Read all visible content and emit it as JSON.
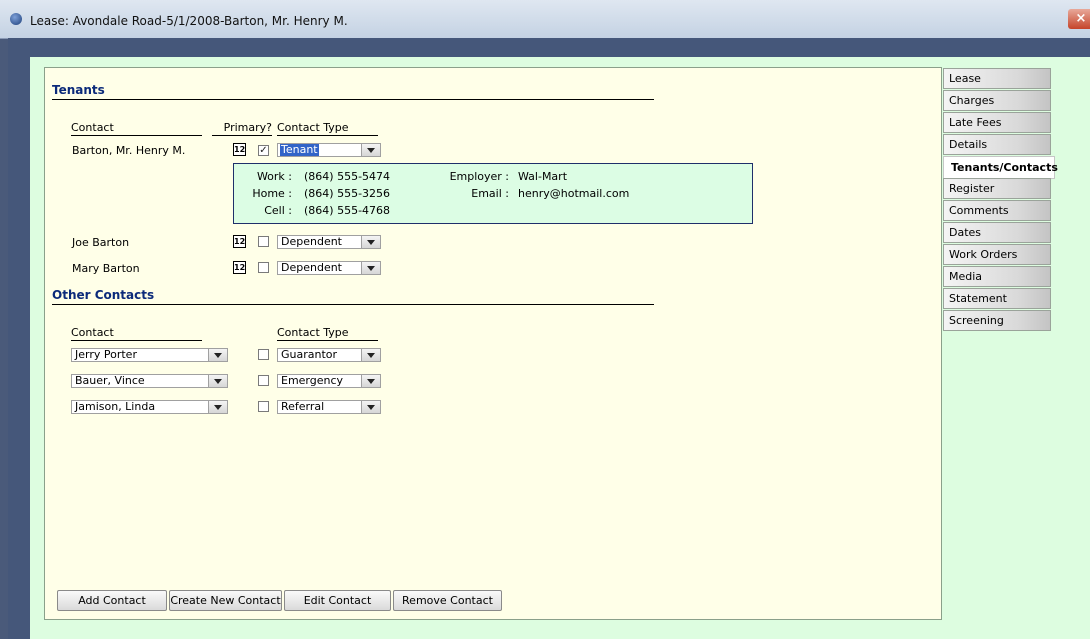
{
  "window": {
    "title": "Lease: Avondale Road-5/1/2008-Barton, Mr. Henry M.",
    "close_glyph": "×"
  },
  "tenants": {
    "title": "Tenants",
    "headers": {
      "contact": "Contact",
      "primary": "Primary?",
      "contact_type": "Contact Type"
    },
    "rows": [
      {
        "name": "Barton, Mr. Henry M.",
        "primary": true,
        "type": "Tenant"
      },
      {
        "name": "Joe Barton",
        "primary": false,
        "type": "Dependent"
      },
      {
        "name": "Mary Barton",
        "primary": false,
        "type": "Dependent"
      }
    ],
    "details": {
      "work_label": "Work :",
      "work": "(864) 555-5474",
      "home_label": "Home :",
      "home": "(864) 555-3256",
      "cell_label": "Cell :",
      "cell": "(864) 555-4768",
      "employer_label": "Employer :",
      "employer": "Wal-Mart",
      "email_label": "Email :",
      "email": "henry@hotmail.com"
    },
    "detail_icon_text": "12"
  },
  "other_contacts": {
    "title": "Other Contacts",
    "headers": {
      "contact": "Contact",
      "contact_type": "Contact Type"
    },
    "rows": [
      {
        "name": "Jerry Porter",
        "type": "Guarantor"
      },
      {
        "name": "Bauer, Vince",
        "type": "Emergency"
      },
      {
        "name": "Jamison, Linda",
        "type": "Referral"
      }
    ]
  },
  "tabs": [
    "Lease",
    "Charges",
    "Late Fees",
    "Details",
    "Tenants/Contacts",
    "Register",
    "Comments",
    "Dates",
    "Work Orders",
    "Media",
    "Statement",
    "Screening"
  ],
  "active_tab": "Tenants/Contacts",
  "buttons": {
    "add": "Add Contact",
    "create": "Create New Contact",
    "edit": "Edit Contact",
    "remove": "Remove Contact"
  },
  "colors": {
    "panel_bg": "#ffffe8",
    "outer_bg": "#ddfde0",
    "section_title": "#0b2a7a",
    "selection": "#3164c8"
  }
}
